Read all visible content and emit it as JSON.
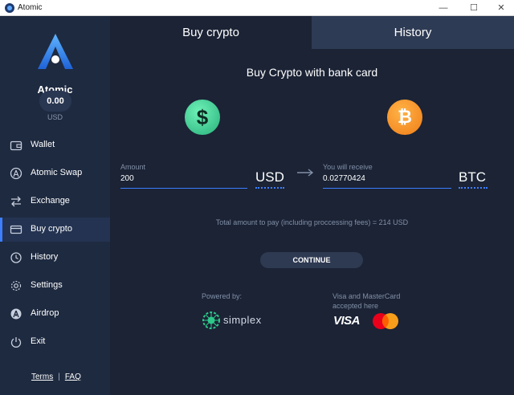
{
  "window": {
    "title": "Atomic",
    "minimize": "—",
    "maximize": "☐",
    "close": "✕"
  },
  "sidebar": {
    "brand": "Atomic",
    "balance": "0.00",
    "balance_currency": "USD",
    "items": [
      {
        "label": "Wallet",
        "icon": "wallet-icon"
      },
      {
        "label": "Atomic Swap",
        "icon": "atomic-swap-icon"
      },
      {
        "label": "Exchange",
        "icon": "exchange-icon"
      },
      {
        "label": "Buy crypto",
        "icon": "card-icon",
        "active": true
      },
      {
        "label": "History",
        "icon": "history-icon"
      },
      {
        "label": "Settings",
        "icon": "gear-icon"
      },
      {
        "label": "Airdrop",
        "icon": "airdrop-icon"
      },
      {
        "label": "Exit",
        "icon": "power-icon"
      }
    ],
    "terms": "Terms",
    "separator": "|",
    "faq": "FAQ"
  },
  "tabs": {
    "buy": "Buy crypto",
    "history": "History"
  },
  "main": {
    "heading": "Buy Crypto with bank card",
    "amount_label": "Amount",
    "amount_value": "200",
    "from_currency": "USD",
    "receive_label": "You will receive",
    "receive_value": "0.02770424",
    "to_currency": "BTC",
    "total": "Total amount to pay (including proccessing fees) = 214 USD",
    "continue_label": "CONTINUE",
    "powered_by": "Powered by:",
    "simplex": "simplex",
    "cards_label": "Visa and MasterCard accepted here",
    "visa": "VISA"
  },
  "colors": {
    "accent": "#3d7fff",
    "background": "#1b2335",
    "sidebar": "#1e2a40",
    "usd_coin": "#2ec98a",
    "btc_coin": "#f7931a"
  }
}
